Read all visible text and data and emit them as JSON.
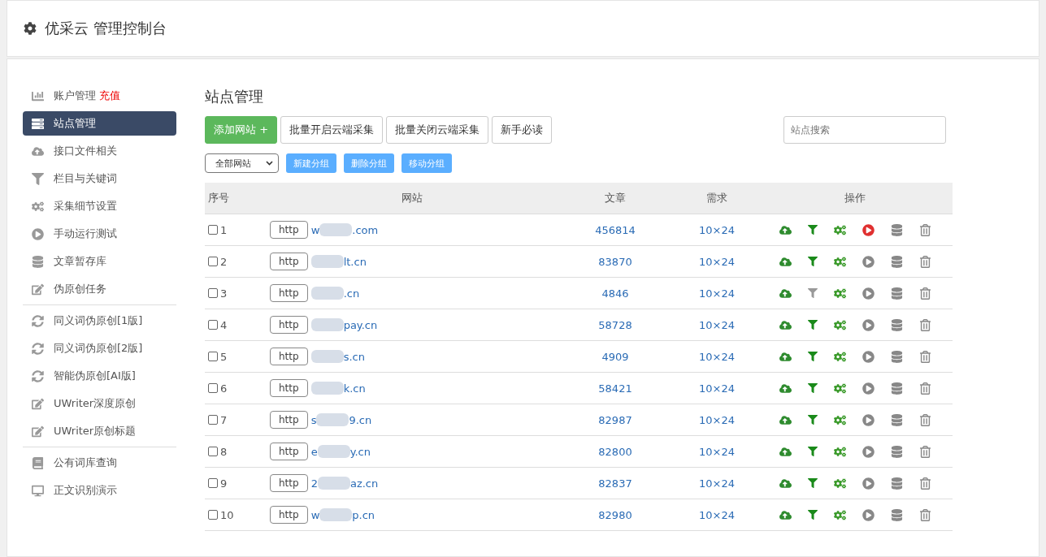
{
  "header": {
    "title": "优采云 管理控制台"
  },
  "sidebar": {
    "groups": [
      [
        {
          "label": "账户管理",
          "badge": "充值",
          "selected": false
        },
        {
          "label": "站点管理",
          "selected": true
        },
        {
          "label": "接口文件相关",
          "selected": false
        },
        {
          "label": "栏目与关键词",
          "selected": false
        },
        {
          "label": "采集细节设置",
          "selected": false
        },
        {
          "label": "手动运行测试",
          "selected": false
        },
        {
          "label": "文章暂存库",
          "selected": false
        },
        {
          "label": "伪原创任务",
          "selected": false
        }
      ],
      [
        {
          "label": "同义词伪原创[1版]",
          "selected": false
        },
        {
          "label": "同义词伪原创[2版]",
          "selected": false
        },
        {
          "label": "智能伪原创[AI版]",
          "selected": false
        },
        {
          "label": "UWriter深度原创",
          "selected": false
        },
        {
          "label": "UWriter原创标题",
          "selected": false
        }
      ],
      [
        {
          "label": "公有词库查询",
          "selected": false
        },
        {
          "label": "正文识别演示",
          "selected": false
        }
      ]
    ]
  },
  "main": {
    "title": "站点管理",
    "buttons": [
      {
        "label": "添加网站 +",
        "kind": "primary"
      },
      {
        "label": "批量开启云端采集",
        "kind": "default"
      },
      {
        "label": "批量关闭云端采集",
        "kind": "default"
      },
      {
        "label": "新手必读",
        "kind": "default"
      }
    ],
    "search": {
      "placeholder": "站点搜索"
    },
    "group_select": {
      "value": "全部网站"
    },
    "group_buttons": [
      "新建分组",
      "删除分组",
      "移动分组"
    ],
    "table": {
      "columns": [
        "序号",
        "网站",
        "文章",
        "需求",
        "操作"
      ],
      "rows": [
        {
          "no": "1",
          "checked": false,
          "scheme": "http",
          "site_start": "w",
          "site_end": ".com",
          "articles": "456814",
          "demand": "10×24",
          "filter_on": true,
          "running": true
        },
        {
          "no": "2",
          "checked": false,
          "scheme": "http",
          "site_end": "lt.cn",
          "articles": "83870",
          "demand": "10×24",
          "filter_on": true,
          "running": false
        },
        {
          "no": "3",
          "checked": false,
          "scheme": "http",
          "site_end": ".cn",
          "articles": "4846",
          "demand": "10×24",
          "filter_on": false,
          "running": false
        },
        {
          "no": "4",
          "checked": false,
          "scheme": "http",
          "site_end": "pay.cn",
          "articles": "58728",
          "demand": "10×24",
          "filter_on": true,
          "running": false
        },
        {
          "no": "5",
          "checked": false,
          "scheme": "http",
          "site_end": "s.cn",
          "articles": "4909",
          "demand": "10×24",
          "filter_on": true,
          "running": false
        },
        {
          "no": "6",
          "checked": false,
          "scheme": "http",
          "site_end": "k.cn",
          "articles": "58421",
          "demand": "10×24",
          "filter_on": true,
          "running": false
        },
        {
          "no": "7",
          "checked": false,
          "scheme": "http",
          "site_start": "s",
          "site_end": "9.cn",
          "articles": "82987",
          "demand": "10×24",
          "filter_on": true,
          "running": false
        },
        {
          "no": "8",
          "checked": false,
          "scheme": "http",
          "site_start": "e",
          "site_end": "y.cn",
          "articles": "82800",
          "demand": "10×24",
          "filter_on": true,
          "running": false
        },
        {
          "no": "9",
          "checked": false,
          "scheme": "http",
          "site_start": "2",
          "site_end": "az.cn",
          "articles": "82837",
          "demand": "10×24",
          "filter_on": true,
          "running": false
        },
        {
          "no": "10",
          "checked": false,
          "scheme": "http",
          "site_start": "w",
          "site_end": "p.cn",
          "articles": "82980",
          "demand": "10×24",
          "filter_on": true,
          "running": false
        }
      ]
    }
  }
}
